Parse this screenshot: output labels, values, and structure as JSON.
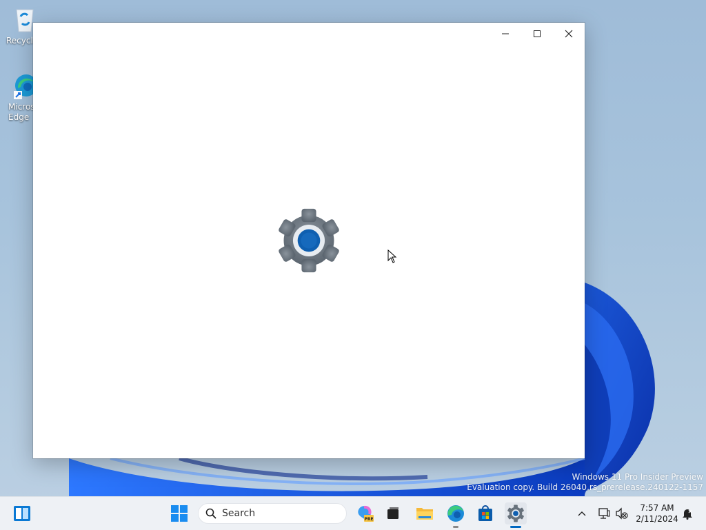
{
  "desktop": {
    "icons": [
      {
        "label": "Recycle",
        "icon": "recycle-bin-icon"
      },
      {
        "label": "Micros\nEdge",
        "icon": "edge-shortcut-icon"
      }
    ],
    "watermark": {
      "line1": "Windows 11 Pro Insider Preview",
      "line2": "Evaluation copy. Build 26040.rs_prerelease.240122-1157"
    }
  },
  "window": {
    "controls": [
      "minimize",
      "maximize",
      "close"
    ],
    "splash_icon": "settings-gear-icon"
  },
  "taskbar": {
    "search_placeholder": "Search",
    "apps": [
      "start-icon",
      "copilot-icon",
      "task-view-icon",
      "file-explorer-icon",
      "edge-icon",
      "store-icon",
      "settings-icon"
    ],
    "clock": {
      "time": "7:57 AM",
      "date": "2/11/2024"
    },
    "colors": {
      "accent": "#0067c0",
      "taskbar_bg": "#eef1f5"
    }
  }
}
